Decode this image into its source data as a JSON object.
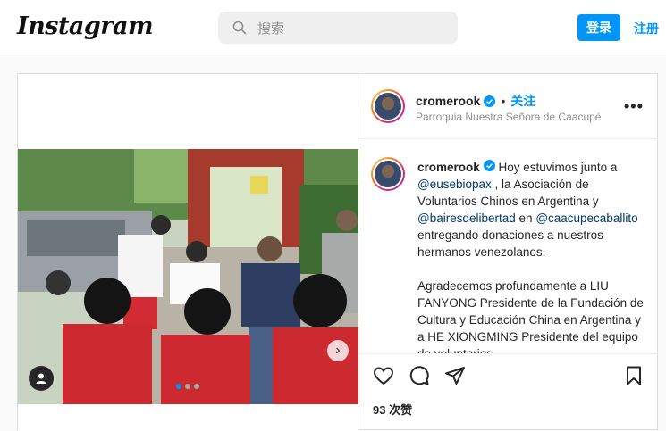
{
  "header": {
    "logo": "Instagram",
    "search_placeholder": "搜索",
    "login_label": "登录",
    "signup_label": "注册"
  },
  "post": {
    "username": "cromerook",
    "follow_label": "关注",
    "separator": "•",
    "location": "Parroquia Nuestra Señora de Caacupé",
    "more_label": "•••",
    "caption": {
      "t1": " Hoy estuvimos junto a ",
      "m1": "@eusebiopax",
      "t2": " , la Asociación de Voluntarios Chinos en Argentina y ",
      "m2": "@bairesdelibertad",
      "t3": " en ",
      "m3": "@caacupecaballito",
      "t4": " entregando donaciones a nuestros hermanos venezolanos.",
      "p2": "Agradecemos profundamente a LIU FANYONG Presidente de la Fundación de Cultura y Educación China en Argentina y a HE XIONGMING Presidente del equipo de voluntarios"
    },
    "likes_label": "93 次赞",
    "carousel_next": "›",
    "carousel_index": 1,
    "carousel_count": 3
  },
  "colors": {
    "accent": "#0095f6",
    "mention": "#00376b",
    "muted": "#8e8e8e"
  },
  "icons": [
    "search-icon",
    "verified-badge-icon",
    "more-options-icon",
    "heart-icon",
    "comment-icon",
    "share-icon",
    "bookmark-icon",
    "user-tag-icon",
    "chevron-right-icon"
  ]
}
